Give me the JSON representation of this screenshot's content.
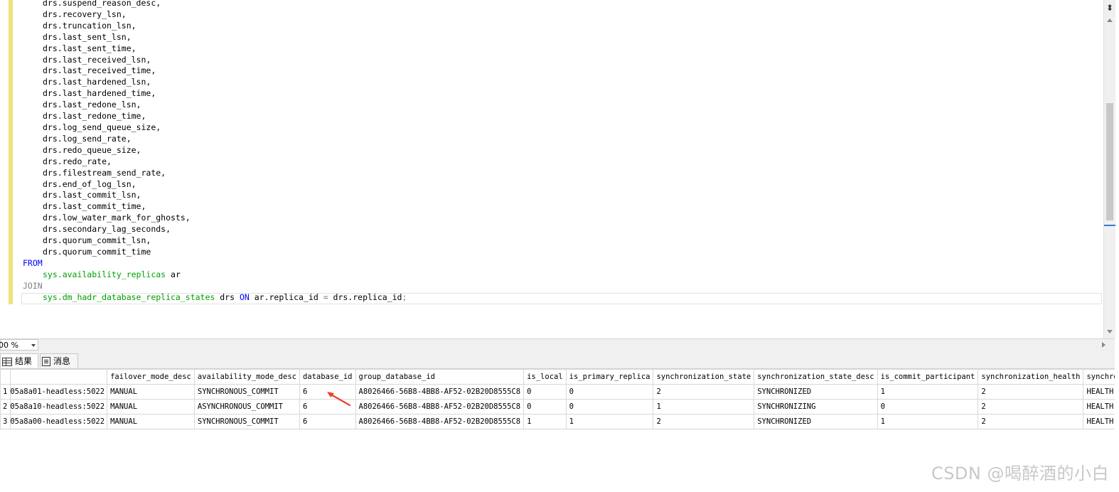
{
  "editor": {
    "lines": [
      {
        "indent": true,
        "parts": [
          {
            "t": "drs.suspend_reason_desc,"
          }
        ]
      },
      {
        "indent": true,
        "parts": [
          {
            "t": "drs.recovery_lsn,"
          }
        ]
      },
      {
        "indent": true,
        "parts": [
          {
            "t": "drs.truncation_lsn,"
          }
        ]
      },
      {
        "indent": true,
        "parts": [
          {
            "t": "drs.last_sent_lsn,"
          }
        ]
      },
      {
        "indent": true,
        "parts": [
          {
            "t": "drs.last_sent_time,"
          }
        ]
      },
      {
        "indent": true,
        "parts": [
          {
            "t": "drs.last_received_lsn,"
          }
        ]
      },
      {
        "indent": true,
        "parts": [
          {
            "t": "drs.last_received_time,"
          }
        ]
      },
      {
        "indent": true,
        "parts": [
          {
            "t": "drs.last_hardened_lsn,"
          }
        ]
      },
      {
        "indent": true,
        "parts": [
          {
            "t": "drs.last_hardened_time,"
          }
        ]
      },
      {
        "indent": true,
        "parts": [
          {
            "t": "drs.last_redone_lsn,"
          }
        ]
      },
      {
        "indent": true,
        "parts": [
          {
            "t": "drs.last_redone_time,"
          }
        ]
      },
      {
        "indent": true,
        "parts": [
          {
            "t": "drs.log_send_queue_size,"
          }
        ]
      },
      {
        "indent": true,
        "parts": [
          {
            "t": "drs.log_send_rate,"
          }
        ]
      },
      {
        "indent": true,
        "parts": [
          {
            "t": "drs.redo_queue_size,"
          }
        ]
      },
      {
        "indent": true,
        "parts": [
          {
            "t": "drs.redo_rate,"
          }
        ]
      },
      {
        "indent": true,
        "parts": [
          {
            "t": "drs.filestream_send_rate,"
          }
        ]
      },
      {
        "indent": true,
        "parts": [
          {
            "t": "drs.end_of_log_lsn,"
          }
        ]
      },
      {
        "indent": true,
        "parts": [
          {
            "t": "drs.last_commit_lsn,"
          }
        ]
      },
      {
        "indent": true,
        "parts": [
          {
            "t": "drs.last_commit_time,"
          }
        ]
      },
      {
        "indent": true,
        "parts": [
          {
            "t": "drs.low_water_mark_for_ghosts,"
          }
        ]
      },
      {
        "indent": true,
        "parts": [
          {
            "t": "drs.secondary_lag_seconds,"
          }
        ]
      },
      {
        "indent": true,
        "parts": [
          {
            "t": "drs.quorum_commit_lsn,"
          }
        ]
      },
      {
        "indent": true,
        "parts": [
          {
            "t": "drs.quorum_commit_time"
          }
        ]
      },
      {
        "indent": false,
        "parts": [
          {
            "t": "FROM",
            "c": "kw"
          }
        ]
      },
      {
        "indent": true,
        "parts": [
          {
            "t": "sys.availability_replicas",
            "c": "sysobj"
          },
          {
            "t": " ar"
          }
        ]
      },
      {
        "indent": false,
        "parts": [
          {
            "t": "JOIN",
            "c": "kw-grey"
          }
        ]
      },
      {
        "indent": true,
        "parts": [
          {
            "t": "sys.dm_hadr_database_replica_states",
            "c": "sysobj"
          },
          {
            "t": " drs "
          },
          {
            "t": "ON",
            "c": "kw"
          },
          {
            "t": " ar.replica_id "
          },
          {
            "t": "=",
            "c": "kw-grey"
          },
          {
            "t": " drs.replica_id"
          },
          {
            "t": ";",
            "c": "kw-grey"
          }
        ]
      }
    ]
  },
  "zoom": {
    "value": "00 %"
  },
  "result_tabs": {
    "results": "结果",
    "messages": "消息"
  },
  "grid": {
    "columns": [
      "",
      "",
      "failover_mode_desc",
      "availability_mode_desc",
      "database_id",
      "group_database_id",
      "is_local",
      "is_primary_replica",
      "synchronization_state",
      "synchronization_state_desc",
      "is_commit_participant",
      "synchronization_health",
      "synchro"
    ],
    "rows": [
      [
        "1",
        "05a8a01-headless:5022",
        "MANUAL",
        "SYNCHRONOUS_COMMIT",
        "6",
        "A8026466-56B8-4BB8-AF52-02B20D8555C8",
        "0",
        "0",
        "2",
        "SYNCHRONIZED",
        "1",
        "2",
        "HEALTH"
      ],
      [
        "2",
        "05a8a10-headless:5022",
        "MANUAL",
        "ASYNCHRONOUS_COMMIT",
        "6",
        "A8026466-56B8-4BB8-AF52-02B20D8555C8",
        "0",
        "0",
        "1",
        "SYNCHRONIZING",
        "0",
        "2",
        "HEALTH"
      ],
      [
        "3",
        "05a8a00-headless:5022",
        "MANUAL",
        "SYNCHRONOUS_COMMIT",
        "6",
        "A8026466-56B8-4BB8-AF52-02B20D8555C8",
        "1",
        "1",
        "2",
        "SYNCHRONIZED",
        "1",
        "2",
        "HEALTH"
      ]
    ]
  },
  "annotation": {
    "color": "#e8412c"
  },
  "watermark": "CSDN @喝醉酒的小白"
}
